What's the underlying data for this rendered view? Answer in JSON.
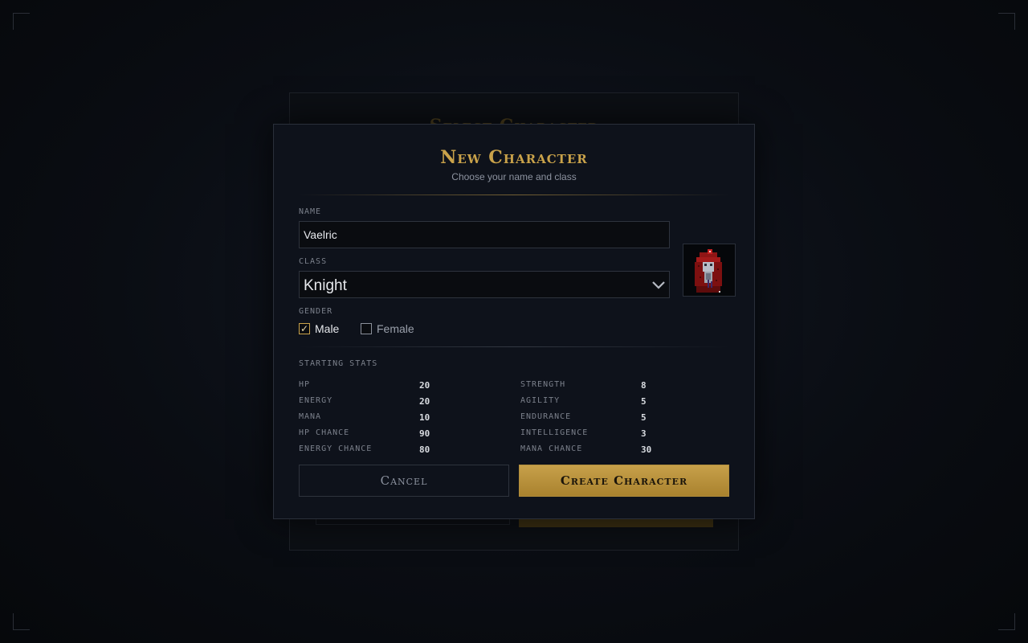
{
  "background": {
    "title": "Select Character"
  },
  "modal": {
    "title": "New Character",
    "subtitle": "Choose your name and class",
    "name_label": "NAME",
    "name_value": "Vaelric",
    "class_label": "CLASS",
    "class_value": "Knight",
    "gender_label": "GENDER",
    "gender_options": [
      {
        "label": "Male",
        "checked": true
      },
      {
        "label": "Female",
        "checked": false
      }
    ],
    "portrait_icon": "knight-portrait-icon",
    "stats_label": "STARTING STATS",
    "stats_left": [
      {
        "name": "HP",
        "value": "20"
      },
      {
        "name": "ENERGY",
        "value": "20"
      },
      {
        "name": "MANA",
        "value": "10"
      },
      {
        "name": "HP CHANCE",
        "value": "90"
      },
      {
        "name": "ENERGY CHANCE",
        "value": "80"
      }
    ],
    "stats_right": [
      {
        "name": "STRENGTH",
        "value": "8"
      },
      {
        "name": "AGILITY",
        "value": "5"
      },
      {
        "name": "ENDURANCE",
        "value": "5"
      },
      {
        "name": "INTELLIGENCE",
        "value": "3"
      },
      {
        "name": "MANA CHANCE",
        "value": "30"
      }
    ],
    "cancel_label": "Cancel",
    "create_label": "Create Character"
  },
  "colors": {
    "accent_gold": "#c9a24a",
    "panel": "#0e121b",
    "background": "#07090d"
  }
}
